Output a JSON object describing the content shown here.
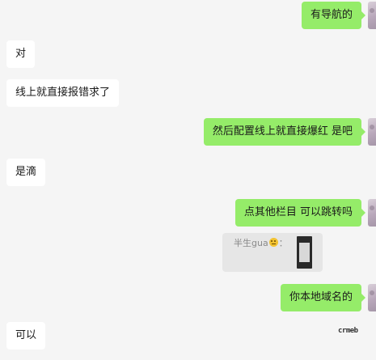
{
  "messages": [
    {
      "side": "right",
      "text": "有导航的"
    },
    {
      "side": "left",
      "text": "对"
    },
    {
      "side": "left",
      "text": "线上就直接报错求了"
    },
    {
      "side": "right",
      "text": "然后配置线上就直接爆红 是吧"
    },
    {
      "side": "left",
      "text": "是滴"
    },
    {
      "side": "right",
      "text": "点其他栏目 可以跳转吗"
    },
    {
      "side": "right",
      "text": "你本地域名的"
    },
    {
      "side": "left",
      "text": "可以"
    }
  ],
  "quote": {
    "name": "半生gua",
    "colon": "："
  },
  "watermark": "crmeb",
  "colors": {
    "background": "#f5f5f5",
    "self_bubble": "#95ec69",
    "other_bubble": "#ffffff",
    "quote_bg": "#e6e6e6"
  }
}
